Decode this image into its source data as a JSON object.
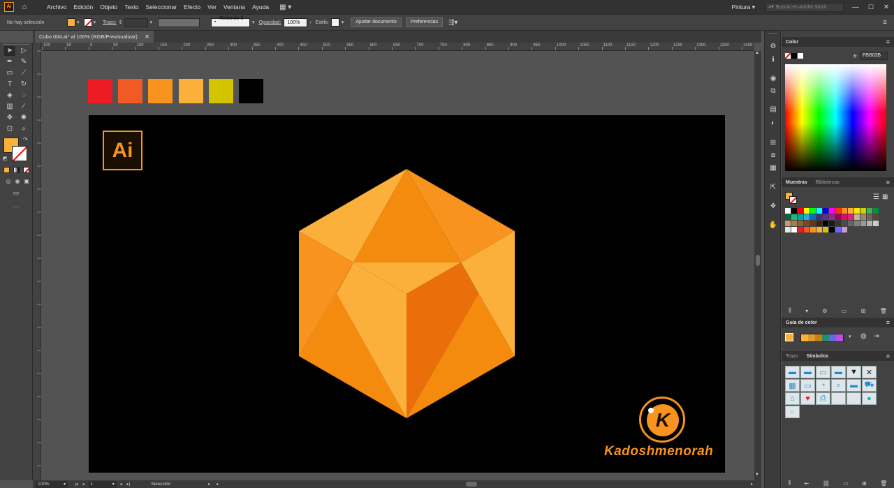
{
  "menu": {
    "items": [
      "Archivo",
      "Edición",
      "Objeto",
      "Texto",
      "Seleccionar",
      "Efecto",
      "Ver",
      "Ventana",
      "Ayuda"
    ],
    "workspace": "Pintura",
    "search_placeholder": "Buscar en Adobe Stock"
  },
  "control": {
    "selection_label": "No hay selección",
    "stroke_label": "Trazo:",
    "brush_label": "Redondo 3 ...",
    "opacity_label": "Opacidad:",
    "opacity_value": "100%",
    "style_label": "Estilo:",
    "fit_button": "Ajustar documento",
    "prefs_button": "Preferencias",
    "fill_color": "#FBB03B"
  },
  "document": {
    "tab_title": "Cubo 004.ai* al 100% (RGB/Previsualizar)"
  },
  "ruler": {
    "marks": [
      "100",
      "50",
      "0",
      "50",
      "100",
      "150",
      "200",
      "250",
      "300",
      "350",
      "400",
      "450",
      "500",
      "550",
      "600",
      "650",
      "700",
      "750",
      "800",
      "850",
      "900",
      "950",
      "1000",
      "1050",
      "1100",
      "1150",
      "1200",
      "1250",
      "1300",
      "1350",
      "1400"
    ]
  },
  "palette_chips": [
    "#ED1C24",
    "#F15A24",
    "#F7931E",
    "#FBB03B",
    "#D4C400",
    "#000000"
  ],
  "artboard": {
    "ai_badge": "Ai",
    "watermark_letter": "K",
    "watermark_text": "Kadoshmenorah",
    "cube_colors": {
      "top_light": "#FBB03B",
      "orange": "#F7931E",
      "mid": "#F48A0E",
      "dark": "#EA6F0A"
    }
  },
  "status": {
    "zoom": "100%",
    "page": "1",
    "tool": "Selección"
  },
  "panels": {
    "color": {
      "title": "Color",
      "hex": "FBB03B"
    },
    "swatches": {
      "tabs": [
        "Muestras",
        "Bibliotecas"
      ],
      "colors": [
        "#ffffff",
        "#000000",
        "#ff0000",
        "#ffff00",
        "#00ff00",
        "#00ffff",
        "#0000ff",
        "#ff00ff",
        "#ff3300",
        "#F7931E",
        "#FBB03B",
        "#ffe600",
        "#c8d400",
        "#39b54a",
        "#009245",
        "#006837",
        "#22b573",
        "#00a99d",
        "#29abe2",
        "#0071bc",
        "#2e3192",
        "#662d91",
        "#93278f",
        "#9e005d",
        "#d4145a",
        "#ed1e79",
        "#c7b299",
        "#998675",
        "#736357",
        "#534741",
        "#c69c6d",
        "#a67c52",
        "#8c6239",
        "#754c24",
        "#603813",
        "#42210b",
        "#000000",
        "#1a1a1a",
        "#333333",
        "#4d4d4d",
        "#666666",
        "#808080",
        "#999999",
        "#b3b3b3",
        "#cccccc",
        "#e6e6e6",
        "#ffffff",
        "#ED1C24",
        "#F15A24",
        "#F7931E",
        "#FBB03B",
        "#D4C400",
        "#000000",
        "#6666ff",
        "#cc99cc"
      ]
    },
    "color_guide": {
      "title": "Guía de color",
      "colors": [
        "#FBB03B",
        "#e09a2a",
        "#c97f14",
        "#2a8a6a",
        "#5b6fe0",
        "#c04de0"
      ]
    },
    "symbols": {
      "tabs": [
        "Trazo",
        "Símbolos"
      ]
    }
  }
}
